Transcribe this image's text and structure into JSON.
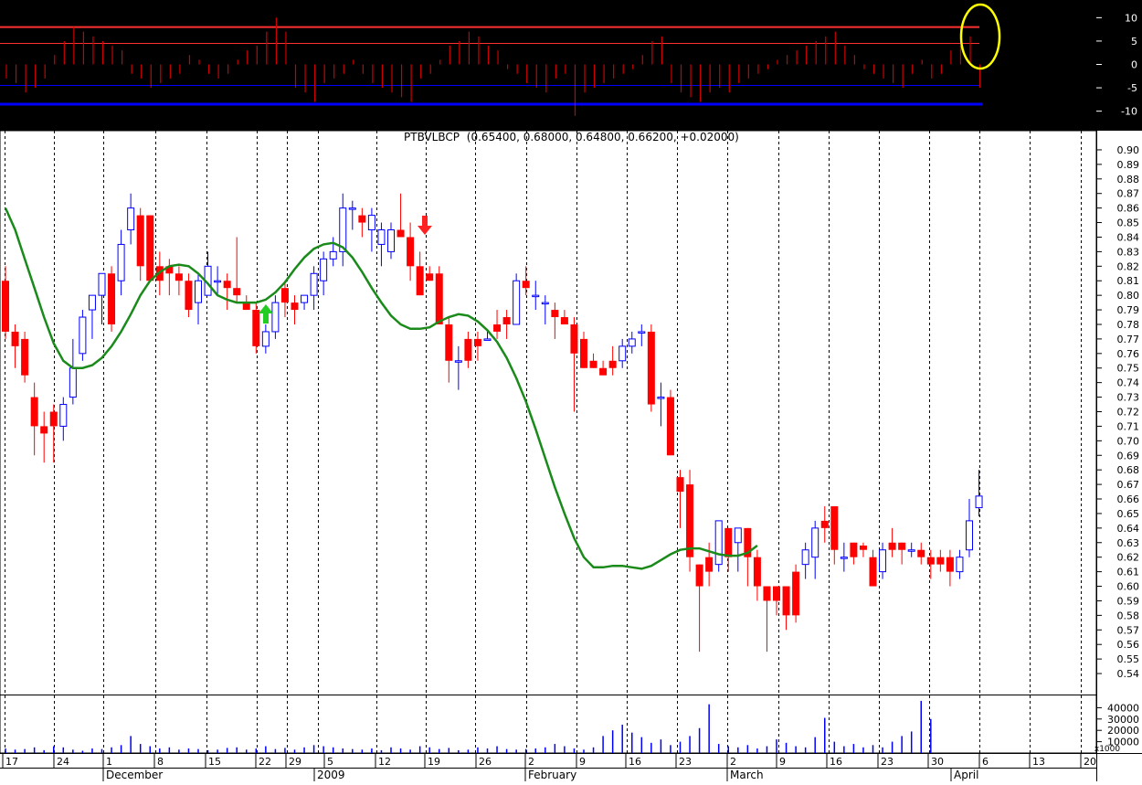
{
  "chart_data": {
    "type": "candlestick",
    "title": "PTBVLBCP",
    "title_values": "(0.65400, 0.68000, 0.64800, 0.66200, +0.02000)",
    "colors": {
      "up_open": "#0000ff",
      "down": "#ff0000",
      "down_filled_blue": "#0000ff",
      "ma_line": "#1a8a1a",
      "grid": "#000000",
      "oscillator_bg": "#000000",
      "osc_bar": "#cc0000",
      "osc_redline": "#ff3030",
      "osc_blueline": "#0000ff",
      "volume": "#0000ff",
      "highlight": "#ffff00"
    },
    "price_axis": {
      "ticks": [
        "0.90",
        "0.89",
        "0.88",
        "0.87",
        "0.86",
        "0.85",
        "0.84",
        "0.83",
        "0.82",
        "0.81",
        "0.80",
        "0.79",
        "0.78",
        "0.77",
        "0.76",
        "0.75",
        "0.74",
        "0.73",
        "0.72",
        "0.71",
        "0.70",
        "0.69",
        "0.68",
        "0.67",
        "0.66",
        "0.65",
        "0.64",
        "0.63",
        "0.62",
        "0.61",
        "0.60",
        "0.59",
        "0.58",
        "0.57",
        "0.56",
        "0.55",
        "0.54"
      ],
      "ylim": [
        0.535,
        0.905
      ]
    },
    "osc_axis": {
      "ticks": [
        "10",
        "5",
        "0",
        "-5",
        "-10"
      ],
      "ylim": [
        -13,
        13
      ],
      "levels": {
        "red_high": 8,
        "red_mid": 4.5,
        "blue_low": -4.5,
        "blue_lower": -8.5
      }
    },
    "volume_axis": {
      "ticks": [
        "40000",
        "30000",
        "20000",
        "10000"
      ],
      "unit_label": "x1000"
    },
    "x_axis": {
      "day_labels": [
        "17",
        "24",
        "1",
        "8",
        "15",
        "22",
        "29",
        "5",
        "12",
        "19",
        "26",
        "2",
        "9",
        "16",
        "23",
        "2",
        "9",
        "16",
        "23",
        "30",
        "6",
        "13",
        "20"
      ],
      "month_labels": [
        "December",
        "2009",
        "February",
        "March",
        "April"
      ]
    },
    "candles": [
      {
        "o": 0.81,
        "h": 0.82,
        "l": 0.77,
        "c": 0.775
      },
      {
        "o": 0.775,
        "h": 0.78,
        "l": 0.75,
        "c": 0.765
      },
      {
        "o": 0.77,
        "h": 0.775,
        "l": 0.74,
        "c": 0.745
      },
      {
        "o": 0.73,
        "h": 0.74,
        "l": 0.69,
        "c": 0.71
      },
      {
        "o": 0.71,
        "h": 0.72,
        "l": 0.685,
        "c": 0.705
      },
      {
        "o": 0.72,
        "h": 0.725,
        "l": 0.685,
        "c": 0.71
      },
      {
        "o": 0.71,
        "h": 0.73,
        "l": 0.7,
        "c": 0.725
      },
      {
        "o": 0.73,
        "h": 0.77,
        "l": 0.725,
        "c": 0.75
      },
      {
        "o": 0.76,
        "h": 0.79,
        "l": 0.755,
        "c": 0.785
      },
      {
        "o": 0.79,
        "h": 0.8,
        "l": 0.77,
        "c": 0.8
      },
      {
        "o": 0.8,
        "h": 0.815,
        "l": 0.78,
        "c": 0.815
      },
      {
        "o": 0.815,
        "h": 0.82,
        "l": 0.775,
        "c": 0.78
      },
      {
        "o": 0.81,
        "h": 0.845,
        "l": 0.8,
        "c": 0.835
      },
      {
        "o": 0.845,
        "h": 0.87,
        "l": 0.835,
        "c": 0.86
      },
      {
        "o": 0.855,
        "h": 0.86,
        "l": 0.81,
        "c": 0.82
      },
      {
        "o": 0.855,
        "h": 0.855,
        "l": 0.81,
        "c": 0.81
      },
      {
        "o": 0.82,
        "h": 0.83,
        "l": 0.8,
        "c": 0.81
      },
      {
        "o": 0.82,
        "h": 0.825,
        "l": 0.8,
        "c": 0.815
      },
      {
        "o": 0.815,
        "h": 0.82,
        "l": 0.8,
        "c": 0.81
      },
      {
        "o": 0.81,
        "h": 0.815,
        "l": 0.785,
        "c": 0.79
      },
      {
        "o": 0.795,
        "h": 0.815,
        "l": 0.78,
        "c": 0.81
      },
      {
        "o": 0.8,
        "h": 0.83,
        "l": 0.8,
        "c": 0.82
      },
      {
        "o": 0.81,
        "h": 0.82,
        "l": 0.8,
        "c": 0.81
      },
      {
        "o": 0.81,
        "h": 0.815,
        "l": 0.79,
        "c": 0.805
      },
      {
        "o": 0.805,
        "h": 0.84,
        "l": 0.795,
        "c": 0.8
      },
      {
        "o": 0.795,
        "h": 0.8,
        "l": 0.79,
        "c": 0.79
      },
      {
        "o": 0.79,
        "h": 0.795,
        "l": 0.76,
        "c": 0.765
      },
      {
        "o": 0.765,
        "h": 0.78,
        "l": 0.76,
        "c": 0.775
      },
      {
        "o": 0.775,
        "h": 0.8,
        "l": 0.77,
        "c": 0.795
      },
      {
        "o": 0.805,
        "h": 0.81,
        "l": 0.785,
        "c": 0.795
      },
      {
        "o": 0.795,
        "h": 0.8,
        "l": 0.78,
        "c": 0.79
      },
      {
        "o": 0.795,
        "h": 0.8,
        "l": 0.79,
        "c": 0.8
      },
      {
        "o": 0.8,
        "h": 0.82,
        "l": 0.79,
        "c": 0.815
      },
      {
        "o": 0.81,
        "h": 0.83,
        "l": 0.8,
        "c": 0.825
      },
      {
        "o": 0.825,
        "h": 0.84,
        "l": 0.82,
        "c": 0.83
      },
      {
        "o": 0.83,
        "h": 0.87,
        "l": 0.82,
        "c": 0.86
      },
      {
        "o": 0.86,
        "h": 0.865,
        "l": 0.845,
        "c": 0.86
      },
      {
        "o": 0.855,
        "h": 0.86,
        "l": 0.84,
        "c": 0.85
      },
      {
        "o": 0.845,
        "h": 0.86,
        "l": 0.83,
        "c": 0.855
      },
      {
        "o": 0.835,
        "h": 0.85,
        "l": 0.82,
        "c": 0.845
      },
      {
        "o": 0.83,
        "h": 0.85,
        "l": 0.825,
        "c": 0.845
      },
      {
        "o": 0.845,
        "h": 0.87,
        "l": 0.84,
        "c": 0.84
      },
      {
        "o": 0.84,
        "h": 0.85,
        "l": 0.81,
        "c": 0.82
      },
      {
        "o": 0.82,
        "h": 0.83,
        "l": 0.8,
        "c": 0.8
      },
      {
        "o": 0.815,
        "h": 0.82,
        "l": 0.81,
        "c": 0.81
      },
      {
        "o": 0.815,
        "h": 0.82,
        "l": 0.78,
        "c": 0.78
      },
      {
        "o": 0.78,
        "h": 0.785,
        "l": 0.74,
        "c": 0.755
      },
      {
        "o": 0.755,
        "h": 0.765,
        "l": 0.735,
        "c": 0.755
      },
      {
        "o": 0.77,
        "h": 0.775,
        "l": 0.75,
        "c": 0.755
      },
      {
        "o": 0.77,
        "h": 0.775,
        "l": 0.755,
        "c": 0.765
      },
      {
        "o": 0.77,
        "h": 0.775,
        "l": 0.77,
        "c": 0.77
      },
      {
        "o": 0.78,
        "h": 0.79,
        "l": 0.77,
        "c": 0.775
      },
      {
        "o": 0.785,
        "h": 0.79,
        "l": 0.77,
        "c": 0.78
      },
      {
        "o": 0.78,
        "h": 0.815,
        "l": 0.78,
        "c": 0.81
      },
      {
        "o": 0.81,
        "h": 0.82,
        "l": 0.8,
        "c": 0.805
      },
      {
        "o": 0.8,
        "h": 0.81,
        "l": 0.79,
        "c": 0.8
      },
      {
        "o": 0.795,
        "h": 0.8,
        "l": 0.78,
        "c": 0.795
      },
      {
        "o": 0.79,
        "h": 0.795,
        "l": 0.77,
        "c": 0.785
      },
      {
        "o": 0.785,
        "h": 0.79,
        "l": 0.78,
        "c": 0.78
      },
      {
        "o": 0.78,
        "h": 0.785,
        "l": 0.72,
        "c": 0.76
      },
      {
        "o": 0.77,
        "h": 0.775,
        "l": 0.75,
        "c": 0.75
      },
      {
        "o": 0.755,
        "h": 0.76,
        "l": 0.75,
        "c": 0.75
      },
      {
        "o": 0.75,
        "h": 0.755,
        "l": 0.745,
        "c": 0.745
      },
      {
        "o": 0.755,
        "h": 0.765,
        "l": 0.745,
        "c": 0.75
      },
      {
        "o": 0.755,
        "h": 0.77,
        "l": 0.75,
        "c": 0.765
      },
      {
        "o": 0.765,
        "h": 0.775,
        "l": 0.76,
        "c": 0.77
      },
      {
        "o": 0.775,
        "h": 0.78,
        "l": 0.765,
        "c": 0.775
      },
      {
        "o": 0.775,
        "h": 0.78,
        "l": 0.72,
        "c": 0.725
      },
      {
        "o": 0.73,
        "h": 0.74,
        "l": 0.71,
        "c": 0.73
      },
      {
        "o": 0.73,
        "h": 0.735,
        "l": 0.69,
        "c": 0.69
      },
      {
        "o": 0.675,
        "h": 0.68,
        "l": 0.64,
        "c": 0.665
      },
      {
        "o": 0.67,
        "h": 0.68,
        "l": 0.61,
        "c": 0.62
      },
      {
        "o": 0.615,
        "h": 0.615,
        "l": 0.555,
        "c": 0.6
      },
      {
        "o": 0.62,
        "h": 0.63,
        "l": 0.6,
        "c": 0.61
      },
      {
        "o": 0.615,
        "h": 0.645,
        "l": 0.61,
        "c": 0.645
      },
      {
        "o": 0.64,
        "h": 0.64,
        "l": 0.61,
        "c": 0.62
      },
      {
        "o": 0.63,
        "h": 0.64,
        "l": 0.61,
        "c": 0.64
      },
      {
        "o": 0.64,
        "h": 0.64,
        "l": 0.6,
        "c": 0.62
      },
      {
        "o": 0.62,
        "h": 0.625,
        "l": 0.59,
        "c": 0.6
      },
      {
        "o": 0.6,
        "h": 0.6,
        "l": 0.555,
        "c": 0.59
      },
      {
        "o": 0.6,
        "h": 0.6,
        "l": 0.58,
        "c": 0.59
      },
      {
        "o": 0.6,
        "h": 0.6,
        "l": 0.57,
        "c": 0.58
      },
      {
        "o": 0.61,
        "h": 0.615,
        "l": 0.575,
        "c": 0.58
      },
      {
        "o": 0.615,
        "h": 0.63,
        "l": 0.605,
        "c": 0.625
      },
      {
        "o": 0.62,
        "h": 0.645,
        "l": 0.605,
        "c": 0.64
      },
      {
        "o": 0.645,
        "h": 0.655,
        "l": 0.63,
        "c": 0.64
      },
      {
        "o": 0.655,
        "h": 0.655,
        "l": 0.615,
        "c": 0.625
      },
      {
        "o": 0.62,
        "h": 0.63,
        "l": 0.61,
        "c": 0.62
      },
      {
        "o": 0.63,
        "h": 0.63,
        "l": 0.615,
        "c": 0.62
      },
      {
        "o": 0.628,
        "h": 0.63,
        "l": 0.62,
        "c": 0.625
      },
      {
        "o": 0.62,
        "h": 0.625,
        "l": 0.6,
        "c": 0.6
      },
      {
        "o": 0.61,
        "h": 0.63,
        "l": 0.605,
        "c": 0.625
      },
      {
        "o": 0.63,
        "h": 0.64,
        "l": 0.62,
        "c": 0.625
      },
      {
        "o": 0.63,
        "h": 0.63,
        "l": 0.615,
        "c": 0.625
      },
      {
        "o": 0.625,
        "h": 0.63,
        "l": 0.62,
        "c": 0.625
      },
      {
        "o": 0.625,
        "h": 0.63,
        "l": 0.615,
        "c": 0.62
      },
      {
        "o": 0.62,
        "h": 0.625,
        "l": 0.605,
        "c": 0.615
      },
      {
        "o": 0.62,
        "h": 0.625,
        "l": 0.61,
        "c": 0.615
      },
      {
        "o": 0.62,
        "h": 0.625,
        "l": 0.6,
        "c": 0.61
      },
      {
        "o": 0.61,
        "h": 0.625,
        "l": 0.605,
        "c": 0.62
      },
      {
        "o": 0.625,
        "h": 0.66,
        "l": 0.62,
        "c": 0.645
      },
      {
        "o": 0.654,
        "h": 0.68,
        "l": 0.648,
        "c": 0.662
      }
    ],
    "ma": [
      0.86,
      0.845,
      0.825,
      0.805,
      0.785,
      0.767,
      0.755,
      0.75,
      0.75,
      0.752,
      0.757,
      0.765,
      0.775,
      0.787,
      0.8,
      0.81,
      0.816,
      0.82,
      0.821,
      0.82,
      0.815,
      0.808,
      0.8,
      0.797,
      0.795,
      0.795,
      0.795,
      0.797,
      0.802,
      0.809,
      0.818,
      0.826,
      0.832,
      0.835,
      0.836,
      0.833,
      0.826,
      0.816,
      0.805,
      0.795,
      0.786,
      0.78,
      0.777,
      0.777,
      0.778,
      0.782,
      0.785,
      0.787,
      0.786,
      0.782,
      0.776,
      0.768,
      0.757,
      0.743,
      0.727,
      0.708,
      0.688,
      0.668,
      0.65,
      0.633,
      0.62,
      0.613,
      0.613,
      0.614,
      0.614,
      0.613,
      0.612,
      0.614,
      0.618,
      0.622,
      0.625,
      0.626,
      0.626,
      0.624,
      0.622,
      0.621,
      0.621,
      0.623,
      0.628
    ],
    "oscillator": [
      -3,
      -4,
      -6,
      -5,
      -3,
      2,
      5,
      8,
      7,
      6,
      5,
      4,
      3,
      -2,
      -3,
      -5,
      -4,
      -3,
      -2,
      2,
      1,
      -2,
      -3,
      -2,
      1,
      3,
      4,
      7,
      10,
      7,
      -5,
      -6,
      -8,
      -4,
      -3,
      -2,
      1,
      -2,
      -4,
      -5,
      -6,
      -7,
      -8,
      -3,
      -2,
      1,
      4,
      5,
      7,
      6,
      4,
      3,
      -1,
      -2,
      -4,
      -5,
      -6,
      -3,
      -2,
      -11,
      -6,
      -5,
      -4,
      -3,
      -2,
      -1,
      2,
      5,
      6,
      -4,
      -6,
      -7,
      -8,
      -6,
      -5,
      -6,
      -4,
      -3,
      -2,
      -1,
      1,
      2,
      3,
      4,
      5,
      6,
      7,
      4,
      2,
      -1,
      -2,
      -3,
      -4,
      -5,
      -2,
      1,
      -3,
      -2,
      3,
      4,
      6,
      -5,
      -6,
      -4,
      -2,
      10
    ],
    "volume": [
      4000,
      3000,
      3500,
      5000,
      2500,
      6000,
      5000,
      3000,
      2000,
      4000,
      3500,
      5000,
      7000,
      15000,
      8000,
      6000,
      4000,
      5000,
      3000,
      4000,
      3500,
      2500,
      3000,
      4500,
      5000,
      3000,
      4000,
      6000,
      3500,
      4500,
      3000,
      5000,
      7000,
      6000,
      5000,
      4000,
      3500,
      3000,
      4000,
      2500,
      5000,
      4000,
      3000,
      6000,
      5000,
      3500,
      4500,
      2500,
      3000,
      5000,
      4000,
      6000,
      3500,
      3000,
      3500,
      4000,
      5000,
      8000,
      6000,
      4000,
      3000,
      5000,
      15000,
      20000,
      25000,
      18000,
      14000,
      9000,
      12000,
      7000,
      10000,
      15000,
      22000,
      43000,
      8000,
      6000,
      5000,
      7000,
      4000,
      6000,
      12000,
      9000,
      6000,
      5000,
      14000,
      31000,
      10000,
      6000,
      8000,
      5000,
      7000,
      5000,
      10000,
      15000,
      19000,
      46000,
      30000
    ]
  }
}
